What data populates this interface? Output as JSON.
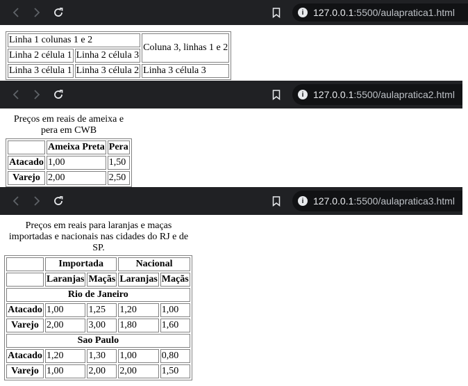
{
  "page1": {
    "url_host": "127.0.0.1",
    "url_path": ":5500/aulapratica1.html",
    "rows": [
      [
        "Linha 1 colunas 1 e 2",
        "Coluna 3, linhas 1 e 2"
      ],
      [
        "Linha 2 célula 1",
        "Linha 2 célula 3"
      ],
      [
        "Linha 3 célula 1",
        "Linha 3 célula 2",
        "Linha 3 célula 3"
      ]
    ]
  },
  "page2": {
    "url_host": "127.0.0.1",
    "url_path": ":5500/aulapratica2.html",
    "caption": "Preços em reais de ameixa e pera em CWB",
    "headers": [
      "",
      "Ameixa Preta",
      "Pera"
    ],
    "rows": [
      {
        "label": "Atacado",
        "values": [
          "1,00",
          "1,50"
        ]
      },
      {
        "label": "Varejo",
        "values": [
          "2,00",
          "2,50"
        ]
      }
    ]
  },
  "page3": {
    "url_host": "127.0.0.1",
    "url_path": ":5500/aulapratica3.html",
    "caption": "Preços em reais para laranjas e maças importadas e nacionais nas cidades do RJ e de SP.",
    "group_headers": [
      "Importada",
      "Nacional"
    ],
    "sub_headers": [
      "Laranjas",
      "Maçãs",
      "Laranjas",
      "Maçãs"
    ],
    "sections": [
      {
        "city": "Rio de Janeiro",
        "rows": [
          {
            "label": "Atacado",
            "values": [
              "1,00",
              "1,25",
              "1,20",
              "1,00"
            ]
          },
          {
            "label": "Varejo",
            "values": [
              "2,00",
              "3,00",
              "1,80",
              "1,60"
            ]
          }
        ]
      },
      {
        "city": "Sao Paulo",
        "rows": [
          {
            "label": "Atacado",
            "values": [
              "1,20",
              "1,30",
              "1,00",
              "0,80"
            ]
          },
          {
            "label": "Varejo",
            "values": [
              "1,00",
              "2,00",
              "2,00",
              "1,50"
            ]
          }
        ]
      }
    ]
  },
  "icons": {
    "back": "back-arrow-icon",
    "forward": "forward-arrow-icon",
    "reload": "reload-icon",
    "bookmark": "bookmark-icon",
    "info": "info-icon"
  }
}
